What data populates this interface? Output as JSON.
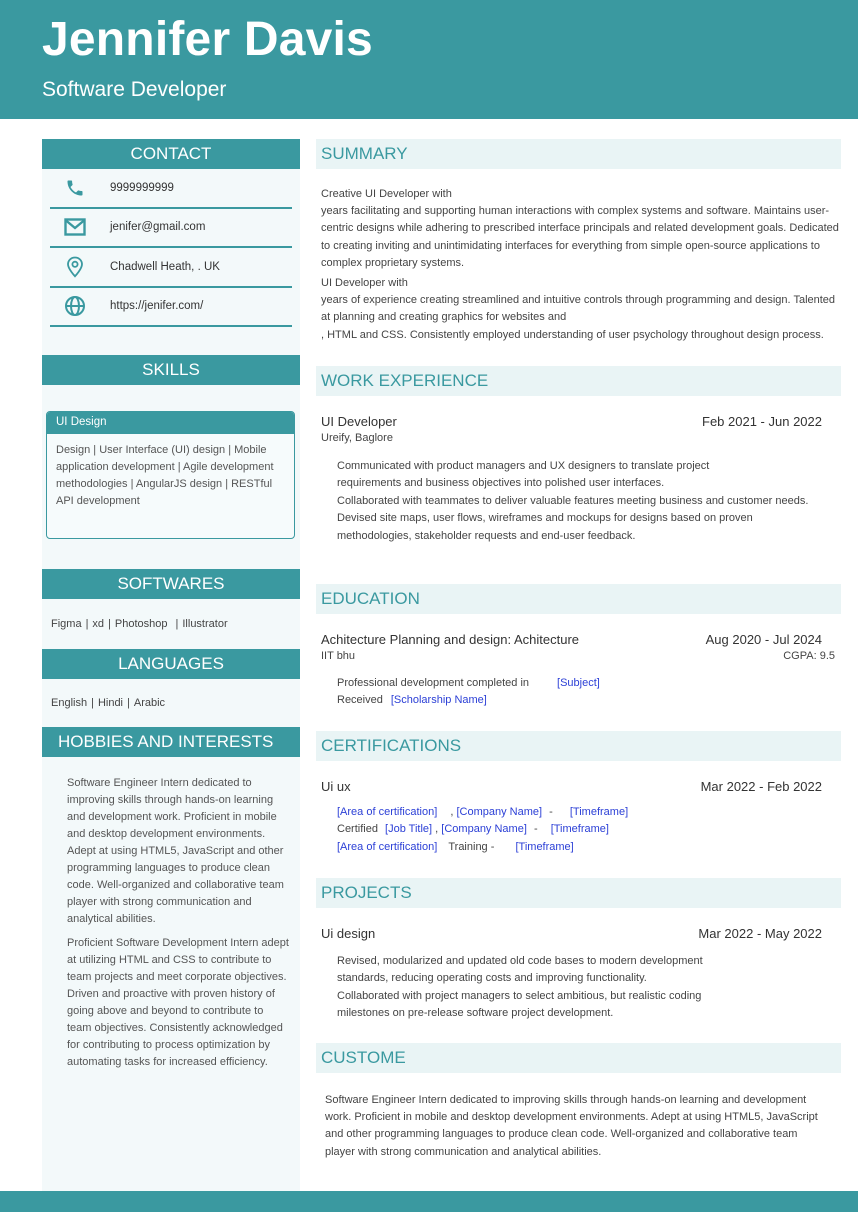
{
  "header": {
    "name": "Jennifer Davis",
    "role": "Software Developer"
  },
  "colors": {
    "accent": "#3a99a0",
    "section_bg": "#e9f4f5",
    "sidebar_bg": "#f3f9fa",
    "placeholder_text": "#2b3fd6"
  },
  "sidebar": {
    "contact": {
      "title": "CONTACT",
      "items": [
        {
          "icon": "phone-icon",
          "text": "9999999999"
        },
        {
          "icon": "mail-icon",
          "text": "jenifer@gmail.com"
        },
        {
          "icon": "location-icon",
          "text": "Chadwell Heath, . UK"
        },
        {
          "icon": "globe-icon",
          "text": "https://jenifer.com/"
        }
      ]
    },
    "skills": {
      "title": "SKILLS",
      "group_title": "UI Design",
      "group_body": "Design | User Interface (UI) design | Mobile application development | Agile development methodologies | AngularJS design | RESTful API development"
    },
    "softwares": {
      "title": "SOFTWARES",
      "items": [
        "Figma",
        "xd",
        "Photoshop",
        "Illustrator"
      ]
    },
    "languages": {
      "title": "LANGUAGES",
      "items": [
        "English",
        "Hindi",
        "Arabic"
      ]
    },
    "hobbies": {
      "title": "HOBBIES AND INTERESTS",
      "paragraphs": [
        "Software Engineer Intern dedicated to improving skills through hands-on learning and development work. Proficient in mobile and desktop development environments. Adept at using HTML5, JavaScript and other programming languages to produce clean code. Well-organized and collaborative team player with strong communication and analytical abilities.",
        "Proficient Software Development Intern adept at utilizing HTML and CSS to contribute to team projects and meet corporate objectives. Driven and proactive with proven history of going above and beyond to contribute to team objectives. Consistently acknowledged for contributing to process optimization by automating tasks for increased efficiency."
      ]
    }
  },
  "main": {
    "summary": {
      "title": "SUMMARY",
      "lines": [
        "Creative UI Developer with",
        "years facilitating and supporting human interactions with complex systems and software. Maintains user-centric designs while adhering to prescribed interface principals and related development goals. Dedicated to creating inviting and unintimidating interfaces for everything from simple open-source applications to complex proprietary systems.",
        "UI Developer with",
        "years of experience creating streamlined and intuitive controls through programming and design. Talented at planning and creating graphics for websites and",
        ", HTML and CSS. Consistently employed understanding of user psychology throughout design process."
      ]
    },
    "work": {
      "title": "WORK EXPERIENCE",
      "role": "UI Developer",
      "dates": "Feb 2021  - Jun 2022",
      "company": "Ureify, Baglore",
      "bullets": [
        "Communicated with product managers and UX designers to translate project requirements and business objectives into polished user interfaces.",
        "Collaborated with teammates to deliver valuable features meeting business and customer needs.",
        "Devised site maps, user flows, wireframes and mockups for designs based on proven methodologies, stakeholder requests and end-user feedback."
      ]
    },
    "education": {
      "title": "EDUCATION",
      "degree": "Achitecture Planning and design: Achitecture",
      "dates": "Aug 2020  - Jul 2024",
      "school": "IIT bhu",
      "gpa": "CGPA: 9.5",
      "line1_text": "Professional development completed in",
      "line1_ph": "[Subject]",
      "line2_text": "Received",
      "line2_ph": "[Scholarship Name]"
    },
    "certifications": {
      "title": "CERTIFICATIONS",
      "name": "Ui ux",
      "dates": "Mar 2022  - Feb 2022",
      "r1": {
        "a": "[Area of certification]",
        "b": ",",
        "c": "[Company Name]",
        "d": "-",
        "e": "[Timeframe]"
      },
      "r2": {
        "a": "Certified",
        "b": "[Job Title]",
        "c": ",",
        "d": "[Company Name]",
        "e": "-",
        "f": "[Timeframe]"
      },
      "r3": {
        "a": "[Area of certification]",
        "b": "Training -",
        "c": "[Timeframe]"
      }
    },
    "projects": {
      "title": "PROJECTS",
      "name": "Ui design",
      "dates": "Mar 2022  - May 2022",
      "bullets": [
        "Revised, modularized and updated old code bases to modern development standards, reducing operating costs and improving functionality.",
        "Collaborated with project managers to select ambitious, but realistic coding milestones on pre-release software project development."
      ]
    },
    "custom": {
      "title": "CUSTOME",
      "text": "Software Engineer Intern dedicated to improving skills through hands-on learning and development work. Proficient in mobile and desktop development environments. Adept at using HTML5, JavaScript and other programming languages to produce clean code. Well-organized and collaborative team player with strong communication and analytical abilities."
    }
  }
}
